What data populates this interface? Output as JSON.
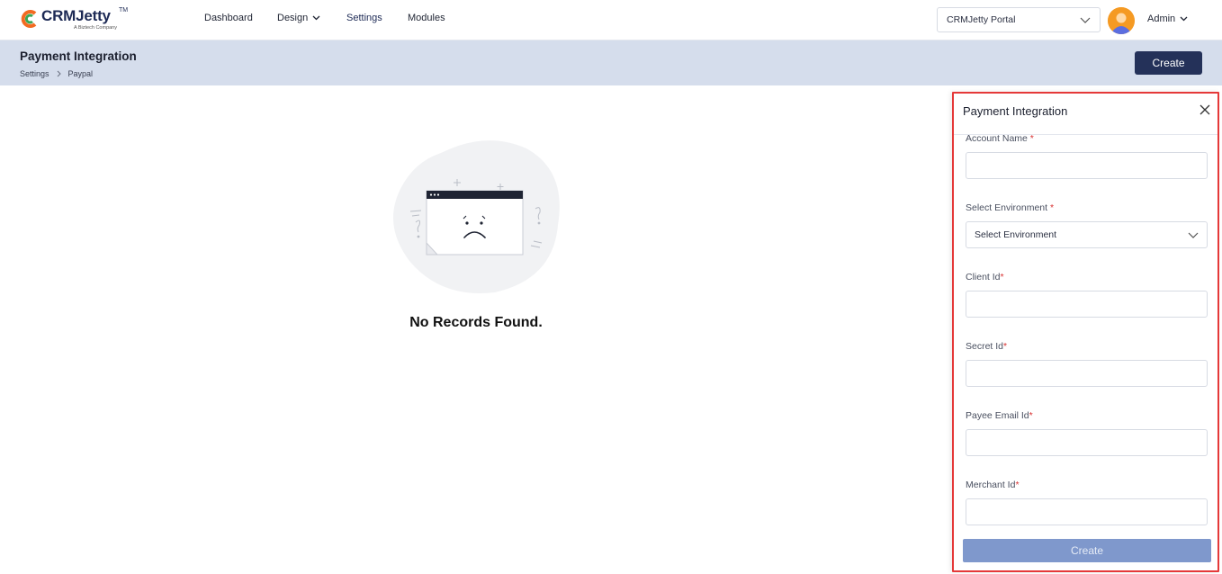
{
  "brand": {
    "name_part1": "CRM",
    "name_part2": "Jetty",
    "trademark": "TM",
    "tagline": "A Biztech Company"
  },
  "nav": {
    "items": [
      {
        "label": "Dashboard"
      },
      {
        "label": "Design"
      },
      {
        "label": "Settings"
      },
      {
        "label": "Modules"
      }
    ]
  },
  "header_right": {
    "portal_select_value": "CRMJetty Portal",
    "user_label": "Admin"
  },
  "subheader": {
    "title": "Payment Integration",
    "breadcrumb": [
      "Settings",
      "Paypal"
    ],
    "create_label": "Create"
  },
  "empty_state": {
    "message": "No Records Found."
  },
  "panel": {
    "title": "Payment Integration",
    "fields": [
      {
        "label": "Account Name",
        "required_mark": "*",
        "value": ""
      },
      {
        "label": "Select Environment",
        "required_mark": "*",
        "selected": "Select Environment"
      },
      {
        "label": "Client Id",
        "required_mark": "*",
        "value": ""
      },
      {
        "label": "Secret Id",
        "required_mark": "*",
        "value": ""
      },
      {
        "label": "Payee Email Id",
        "required_mark": "*",
        "value": ""
      },
      {
        "label": "Merchant Id",
        "required_mark": "*",
        "value": ""
      }
    ],
    "submit_label": "Create"
  },
  "colors": {
    "primary": "#243159",
    "subheader_bg": "#d5ddec",
    "panel_border": "#e53939",
    "submit_disabled": "#7f98cc",
    "logo_orange": "#f26b21",
    "logo_green": "#3aa655"
  }
}
